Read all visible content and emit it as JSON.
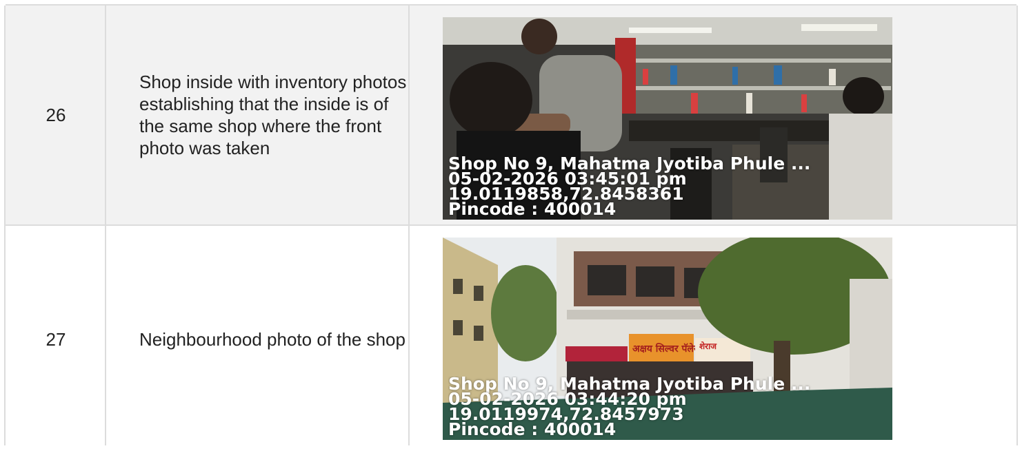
{
  "rows": [
    {
      "number": "26",
      "description": "Shop inside with inventory photos establishing that the inside is of the same shop where the front photo was taken",
      "photo": {
        "subject": "barber shop interior",
        "stamp": [
          "Shop No 9, Mahatma Jyotiba Phule ...",
          "05-02-2026 03:45:01 pm",
          "19.0119858,72.8458361",
          "Pincode : 400014"
        ]
      }
    },
    {
      "number": "27",
      "description": "Neighbourhood photo of the shop",
      "photo": {
        "subject": "street view of building",
        "signboards": [
          "अक्षय सिल्वर पॅलेस",
          "शेराज"
        ],
        "stamp": [
          "Shop No 9, Mahatma Jyotiba Phule ...",
          "05-02-2026 03:44:20 pm",
          "19.0119974,72.8457973",
          "Pincode : 400014"
        ]
      }
    }
  ],
  "colors": {
    "row_alt_bg": "#f2f2f2",
    "border": "#dcdcdc",
    "text": "#222222",
    "stamp_text": "#ffffff"
  }
}
